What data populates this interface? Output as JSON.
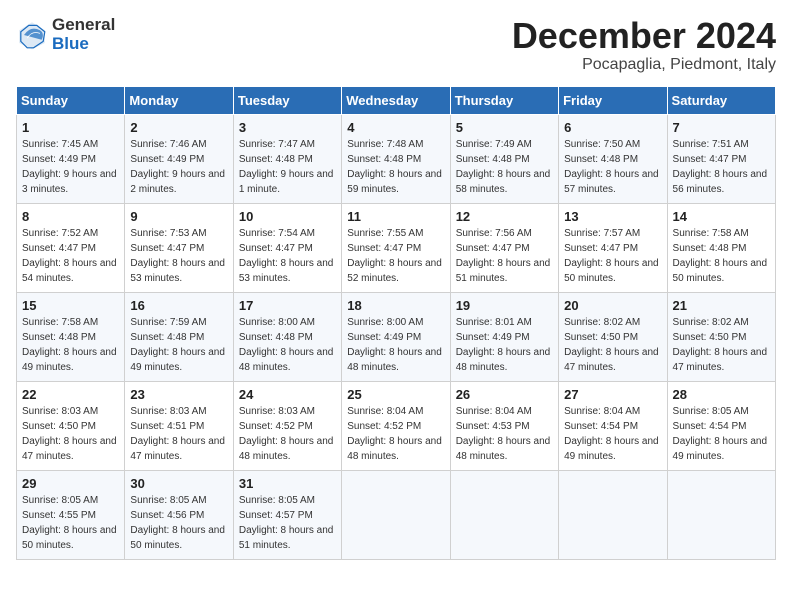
{
  "header": {
    "logo_general": "General",
    "logo_blue": "Blue",
    "month_title": "December 2024",
    "location": "Pocapaglia, Piedmont, Italy"
  },
  "weekdays": [
    "Sunday",
    "Monday",
    "Tuesday",
    "Wednesday",
    "Thursday",
    "Friday",
    "Saturday"
  ],
  "weeks": [
    [
      {
        "day": "1",
        "sunrise": "7:45 AM",
        "sunset": "4:49 PM",
        "daylight": "9 hours and 3 minutes."
      },
      {
        "day": "2",
        "sunrise": "7:46 AM",
        "sunset": "4:49 PM",
        "daylight": "9 hours and 2 minutes."
      },
      {
        "day": "3",
        "sunrise": "7:47 AM",
        "sunset": "4:48 PM",
        "daylight": "9 hours and 1 minute."
      },
      {
        "day": "4",
        "sunrise": "7:48 AM",
        "sunset": "4:48 PM",
        "daylight": "8 hours and 59 minutes."
      },
      {
        "day": "5",
        "sunrise": "7:49 AM",
        "sunset": "4:48 PM",
        "daylight": "8 hours and 58 minutes."
      },
      {
        "day": "6",
        "sunrise": "7:50 AM",
        "sunset": "4:48 PM",
        "daylight": "8 hours and 57 minutes."
      },
      {
        "day": "7",
        "sunrise": "7:51 AM",
        "sunset": "4:47 PM",
        "daylight": "8 hours and 56 minutes."
      }
    ],
    [
      {
        "day": "8",
        "sunrise": "7:52 AM",
        "sunset": "4:47 PM",
        "daylight": "8 hours and 54 minutes."
      },
      {
        "day": "9",
        "sunrise": "7:53 AM",
        "sunset": "4:47 PM",
        "daylight": "8 hours and 53 minutes."
      },
      {
        "day": "10",
        "sunrise": "7:54 AM",
        "sunset": "4:47 PM",
        "daylight": "8 hours and 53 minutes."
      },
      {
        "day": "11",
        "sunrise": "7:55 AM",
        "sunset": "4:47 PM",
        "daylight": "8 hours and 52 minutes."
      },
      {
        "day": "12",
        "sunrise": "7:56 AM",
        "sunset": "4:47 PM",
        "daylight": "8 hours and 51 minutes."
      },
      {
        "day": "13",
        "sunrise": "7:57 AM",
        "sunset": "4:47 PM",
        "daylight": "8 hours and 50 minutes."
      },
      {
        "day": "14",
        "sunrise": "7:58 AM",
        "sunset": "4:48 PM",
        "daylight": "8 hours and 50 minutes."
      }
    ],
    [
      {
        "day": "15",
        "sunrise": "7:58 AM",
        "sunset": "4:48 PM",
        "daylight": "8 hours and 49 minutes."
      },
      {
        "day": "16",
        "sunrise": "7:59 AM",
        "sunset": "4:48 PM",
        "daylight": "8 hours and 49 minutes."
      },
      {
        "day": "17",
        "sunrise": "8:00 AM",
        "sunset": "4:48 PM",
        "daylight": "8 hours and 48 minutes."
      },
      {
        "day": "18",
        "sunrise": "8:00 AM",
        "sunset": "4:49 PM",
        "daylight": "8 hours and 48 minutes."
      },
      {
        "day": "19",
        "sunrise": "8:01 AM",
        "sunset": "4:49 PM",
        "daylight": "8 hours and 48 minutes."
      },
      {
        "day": "20",
        "sunrise": "8:02 AM",
        "sunset": "4:50 PM",
        "daylight": "8 hours and 47 minutes."
      },
      {
        "day": "21",
        "sunrise": "8:02 AM",
        "sunset": "4:50 PM",
        "daylight": "8 hours and 47 minutes."
      }
    ],
    [
      {
        "day": "22",
        "sunrise": "8:03 AM",
        "sunset": "4:50 PM",
        "daylight": "8 hours and 47 minutes."
      },
      {
        "day": "23",
        "sunrise": "8:03 AM",
        "sunset": "4:51 PM",
        "daylight": "8 hours and 47 minutes."
      },
      {
        "day": "24",
        "sunrise": "8:03 AM",
        "sunset": "4:52 PM",
        "daylight": "8 hours and 48 minutes."
      },
      {
        "day": "25",
        "sunrise": "8:04 AM",
        "sunset": "4:52 PM",
        "daylight": "8 hours and 48 minutes."
      },
      {
        "day": "26",
        "sunrise": "8:04 AM",
        "sunset": "4:53 PM",
        "daylight": "8 hours and 48 minutes."
      },
      {
        "day": "27",
        "sunrise": "8:04 AM",
        "sunset": "4:54 PM",
        "daylight": "8 hours and 49 minutes."
      },
      {
        "day": "28",
        "sunrise": "8:05 AM",
        "sunset": "4:54 PM",
        "daylight": "8 hours and 49 minutes."
      }
    ],
    [
      {
        "day": "29",
        "sunrise": "8:05 AM",
        "sunset": "4:55 PM",
        "daylight": "8 hours and 50 minutes."
      },
      {
        "day": "30",
        "sunrise": "8:05 AM",
        "sunset": "4:56 PM",
        "daylight": "8 hours and 50 minutes."
      },
      {
        "day": "31",
        "sunrise": "8:05 AM",
        "sunset": "4:57 PM",
        "daylight": "8 hours and 51 minutes."
      },
      null,
      null,
      null,
      null
    ]
  ]
}
